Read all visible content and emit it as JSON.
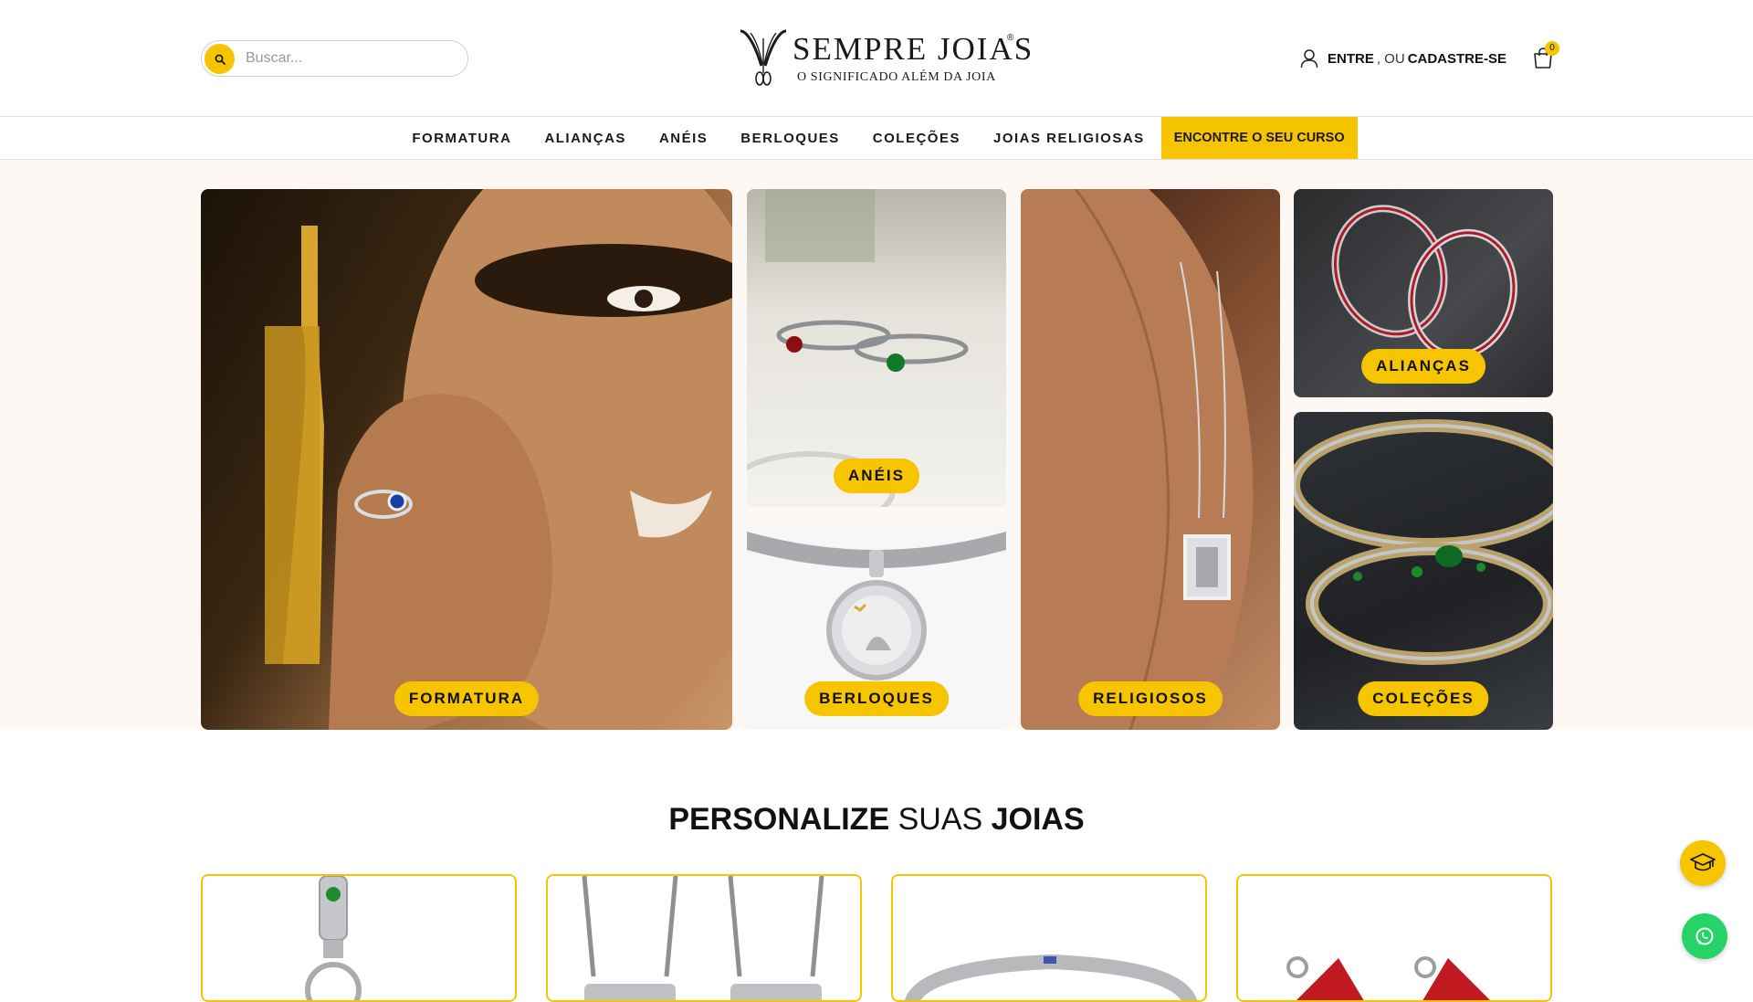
{
  "search": {
    "placeholder": "Buscar...",
    "icon": "search-icon"
  },
  "brand": {
    "name": "SEMPRE JOIAS",
    "reg": "®",
    "tagline": "O SIGNIFICADO ALÉM DA JOIA"
  },
  "account": {
    "login": "ENTRE",
    "or": ", OU",
    "signup": "CADASTRE-SE",
    "icon": "user-icon"
  },
  "cart": {
    "count": "0",
    "icon": "shopping-bag-icon"
  },
  "nav": {
    "items": [
      "FORMATURA",
      "ALIANÇAS",
      "ANÉIS",
      "BERLOQUES",
      "COLEÇÕES",
      "JOIAS RELIGIOSAS"
    ],
    "highlight": "ENCONTRE O SEU CURSO"
  },
  "categories": {
    "formatura": "FORMATURA",
    "aneis": "ANÉIS",
    "berloques": "BERLOQUES",
    "religiosos": "RELIGIOSOS",
    "aliancas": "ALIANÇAS",
    "colecoes": "COLEÇÕES"
  },
  "personalize": {
    "part1": "PERSONALIZE",
    "part2": " SUAS ",
    "part3": "JOIAS"
  },
  "colors": {
    "accent": "#f7c400",
    "whatsapp": "#25d366"
  },
  "floating": {
    "course_icon": "graduation-cap-icon",
    "whatsapp_icon": "whatsapp-icon"
  }
}
